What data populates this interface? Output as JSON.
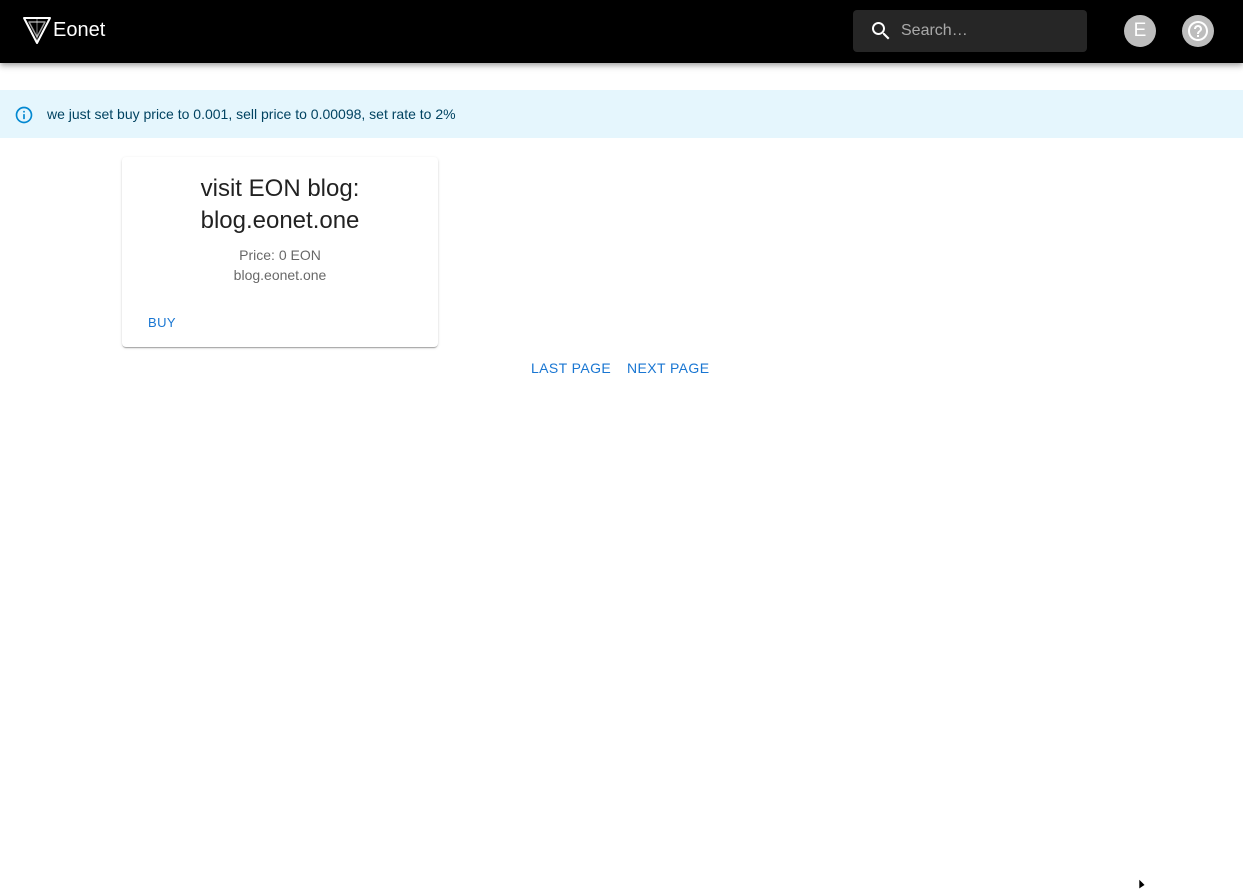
{
  "header": {
    "brand_name": "Eonet",
    "brand_icon": "shield-triangle-logo",
    "background_color": "#000000",
    "search": {
      "placeholder": "Search…",
      "value": "",
      "icon": "search-icon"
    },
    "avatar_letter": "E",
    "help_icon": "help-circle-icon"
  },
  "alert": {
    "severity": "info",
    "icon": "info-outline-icon",
    "message": "we just set buy price to 0.001, sell price to 0.00098, set rate to 2%",
    "background_color": "#e5f6fd",
    "text_color": "#014361"
  },
  "products": [
    {
      "title_line1": "visit EON blog:",
      "title_line2": "blog.eonet.one",
      "price_text": "Price: 0 EON",
      "url_text": "blog.eonet.one",
      "buy_label": "BUY"
    }
  ],
  "pagination": {
    "prev_label": "LAST PAGE",
    "next_label": "NEXT PAGE"
  },
  "accent_color": "#1976d2"
}
